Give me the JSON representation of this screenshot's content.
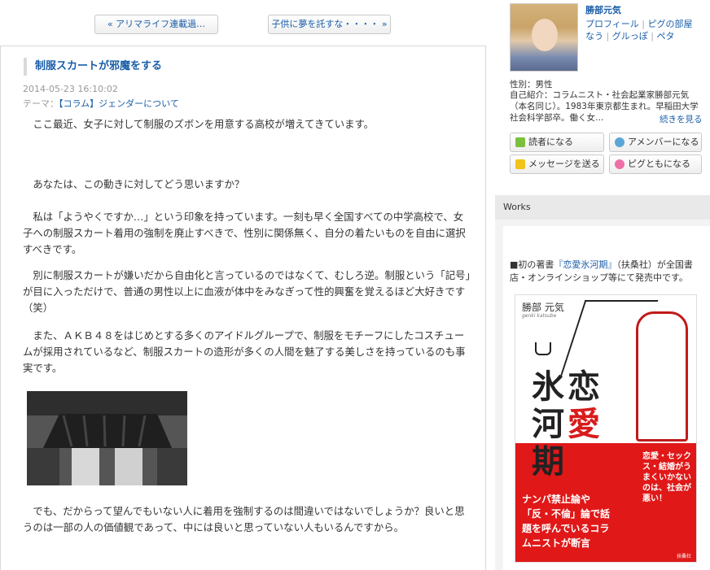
{
  "pager": {
    "prev_label": "« アリマライフ連載過…",
    "next_label": "子供に夢を託すな・・・・ »"
  },
  "article": {
    "title": "制服スカートが邪魔をする",
    "date": "2014-05-23 16:10:02",
    "theme_label": "テーマ：",
    "theme_link": "【コラム】ジェンダーについて",
    "paragraphs": [
      "　ここ最近、女子に対して制服のズボンを用意する高校が増えてきています。",
      "　あなたは、この動きに対してどう思いますか？",
      "　私は「ようやくですか…」という印象を持っています。一刻も早く全国すべての中学高校で、女子への制服スカート着用の強制を廃止すべきで、性別に関係無く、自分の着たいものを自由に選択すべきです。",
      "　別に制服スカートが嫌いだから自由化と言っているのではなくて、むしろ逆。制服という「記号」が目に入っただけで、普通の男性以上に血液が体中をみなぎって性的興奮を覚えるほど大好きです（笑）",
      "　また、ＡＫＢ４８をはじめとする多くのアイドルグループで、制服をモチーフにしたコスチュームが採用されているなど、制服スカートの造形が多くの人間を魅了する美しさを持っているのも事実です。",
      "　でも、だからって望んでもいない人に着用を強制するのは間違いではないでしょうか？良いと思うのは一部の人の価値観であって、中には良いと思っていない人もいるんですから。"
    ]
  },
  "profile": {
    "name": "勝部元気",
    "links": [
      "プロフィール",
      "ピグの部屋",
      "なう",
      "グルっぽ",
      "ペタ"
    ],
    "sex": "性別：男性",
    "intro": "自己紹介：コラムニスト・社会起業家勝部元気（本名同じ）。1983年東京都生まれ。早稲田大学社会科学部卒。働く女…",
    "more": "続きを見る",
    "buttons": {
      "reader": "読者になる",
      "ameba_member": "アメンバーになる",
      "message": "メッセージを送る",
      "pigg": "ピグともになる"
    }
  },
  "works": {
    "heading": "Works",
    "text_prefix": "■初の著書",
    "book_link": "『恋愛氷河期』",
    "text_suffix": "（扶桑社）が全国書店・オンラインショップ等にて発売中です。",
    "cover": {
      "author": "勝部 元気",
      "author_en": "genki katsube",
      "title_chars": [
        "恋",
        "愛",
        "氷",
        "河",
        "期"
      ],
      "panel_main": "ナンパ禁止論や「反・不倫」論で話題を呼んでいるコラムニストが断言",
      "panel_side": "恋愛・セックス・結婚がうまくいかないのは、社会が悪い！",
      "publisher": "扶桑社"
    }
  },
  "colors": {
    "link": "#1a5ea8",
    "book_red": "#e01818"
  }
}
